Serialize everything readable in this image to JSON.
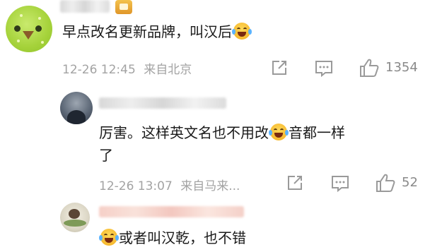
{
  "comments": [
    {
      "text": "早点改名更新品牌，叫汉后",
      "time": "12-26 12:45",
      "location": "来自北京",
      "likes": "1354",
      "emoji": "laughing-tears-emoji"
    },
    {
      "text_part1": "厉害。这样英文名也不用改",
      "text_part2": "音都一样",
      "text_part3": "了",
      "time": "12-26 13:07",
      "location": "来自马来...",
      "likes": "52",
      "emoji": "laughing-tears-emoji"
    },
    {
      "text": "或者叫汉乾，也不错",
      "emoji": "laughing-tears-emoji"
    }
  ],
  "icons": {
    "share": "share-icon",
    "comment": "comment-icon",
    "like": "thumbs-up-icon"
  },
  "colors": {
    "meta_text": "#a3a3a3",
    "action_icon": "#9a9a9a"
  }
}
